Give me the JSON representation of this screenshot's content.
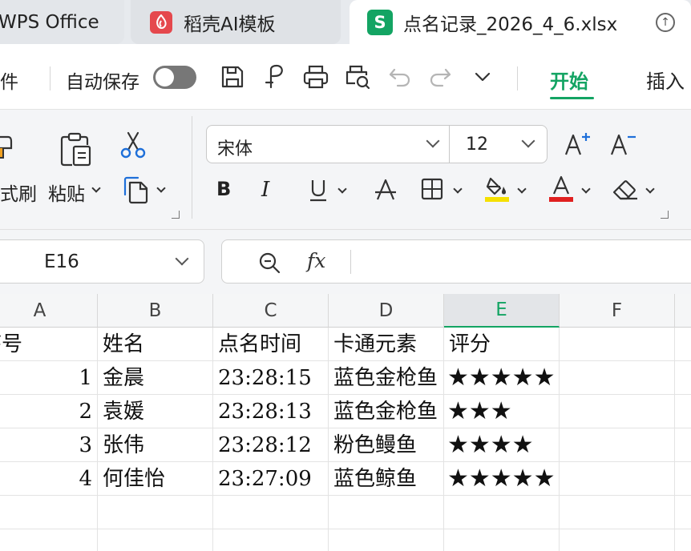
{
  "tabs": {
    "wps": "WPS Office",
    "daoke": "稻壳AI模板",
    "active_file": "点名记录_2026_4_6.xlsx",
    "daoke_icon": "daoke-logo-icon",
    "sheet_icon_letter": "S"
  },
  "quickbar": {
    "file_menu": "件",
    "autosave_label": "自动保存",
    "autosave_on": false,
    "tab_start": "开始",
    "tab_insert": "插入"
  },
  "ribbon": {
    "format_painter": "式刷",
    "paste": "粘贴",
    "font_name": "宋体",
    "font_size": "12",
    "font_color": "#e02020",
    "highlight_color": "#f5e000"
  },
  "formula_bar": {
    "cell_ref": "E16",
    "fx_label": "fx",
    "content": ""
  },
  "grid": {
    "columns": [
      "A",
      "B",
      "C",
      "D",
      "E",
      "F"
    ],
    "selected_column": "E",
    "header_row": [
      "序号",
      "姓名",
      "点名时间",
      "卡通元素",
      "评分"
    ],
    "rows": [
      {
        "no": "1",
        "name": "金晨",
        "time": "23:28:15",
        "element": "蓝色金枪鱼",
        "rating": "★★★★★"
      },
      {
        "no": "2",
        "name": "袁媛",
        "time": "23:28:13",
        "element": "蓝色金枪鱼",
        "rating": "★★★"
      },
      {
        "no": "3",
        "name": "张伟",
        "time": "23:28:12",
        "element": "粉色鳗鱼",
        "rating": "★★★★"
      },
      {
        "no": "4",
        "name": "何佳怡",
        "time": "23:27:09",
        "element": "蓝色鲸鱼",
        "rating": "★★★★★"
      }
    ]
  },
  "colors": {
    "accent": "#13a463"
  }
}
